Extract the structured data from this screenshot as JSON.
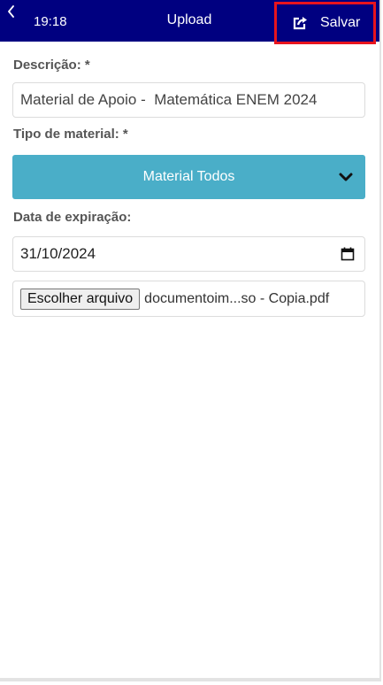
{
  "status_bar": {
    "time": "19:18"
  },
  "header": {
    "title": "Upload",
    "save_label": "Salvar",
    "back_icon": "chevron-left-icon",
    "save_icon": "share-export-icon"
  },
  "form": {
    "description": {
      "label": "Descrição: *",
      "value": "Material de Apoio -  Matemática ENEM 2024"
    },
    "material_type": {
      "label": "Tipo de material: *",
      "selected": "Material Todos",
      "icon": "chevron-down-icon"
    },
    "expiration": {
      "label": "Data de expiração:",
      "value": "31/10/2024",
      "icon": "calendar-icon"
    },
    "file": {
      "button_label": "Escolher arquivo",
      "file_name": "documentoim...so - Copia.pdf"
    }
  },
  "colors": {
    "header_bg": "#000080",
    "select_bg": "#4aaec8",
    "highlight_border": "#e8141e"
  }
}
